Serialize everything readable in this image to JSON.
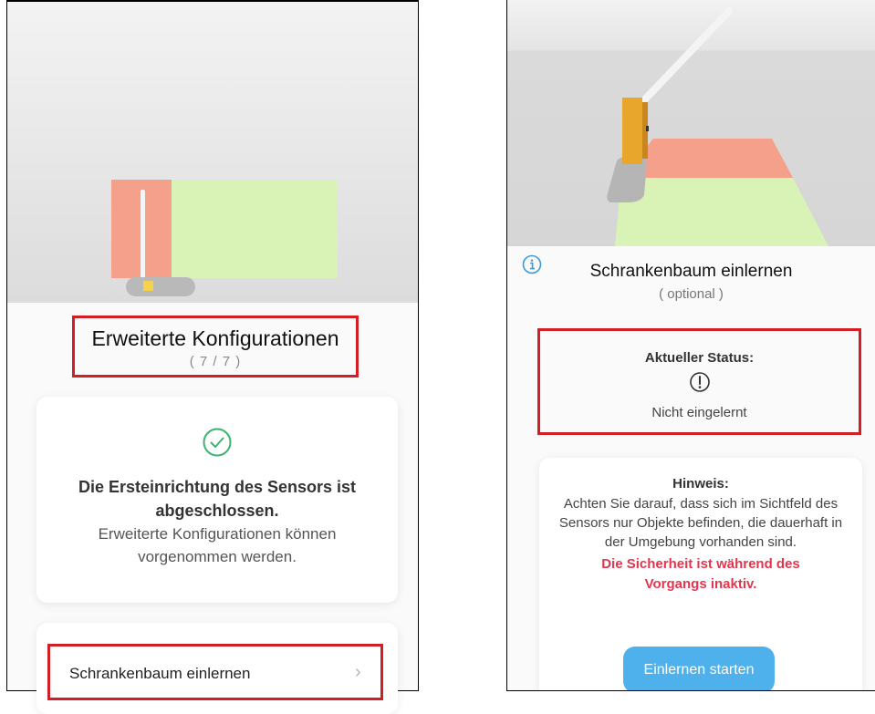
{
  "left": {
    "title": "Erweiterte Konfigurationen",
    "step": "( 7 / 7 )",
    "done_bold": "Die Ersteinrichtung des Sensors ist abgeschlossen.",
    "done_text": "Erweiterte Konfigurationen können vorgenommen werden.",
    "nav_item": "Schrankenbaum einlernen",
    "nav_chevron": "›"
  },
  "right": {
    "title": "Schrankenbaum einlernen",
    "subtitle": "( optional )",
    "status_label": "Aktueller Status:",
    "status_value": "Nicht eingelernt",
    "hint_label": "Hinweis:",
    "hint_text": "Achten Sie darauf, dass sich im Sichtfeld des Sensors nur Objekte befinden, die dauerhaft in der Umgebung vorhanden sind.",
    "hint_warning": "Die Sicherheit ist während des Vorgangs inaktiv.",
    "start_button": "Einlernen starten"
  },
  "icons": {
    "check": "check-circle-icon",
    "info": "info-icon",
    "alert": "exclamation-circle-icon",
    "chevron": "chevron-right-icon"
  },
  "colors": {
    "highlight": "#d21f26",
    "success": "#3cb371",
    "info": "#3a9ad9",
    "warning_text": "#e0374f",
    "button": "#4fb1ec",
    "zone_red": "#f4a08a",
    "zone_green": "#d8f3b5"
  }
}
